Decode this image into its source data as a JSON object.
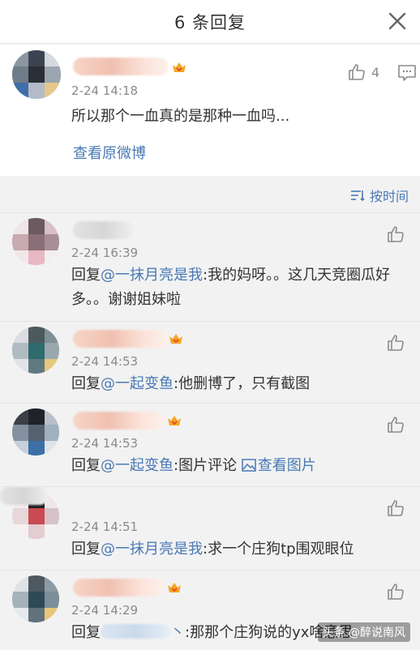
{
  "header": {
    "title": "6 条回复"
  },
  "main_comment": {
    "time": "2-24 14:18",
    "text": "所以那个一血真的是那种一血吗...",
    "like_count": "4",
    "view_original": "查看原微博"
  },
  "sort": {
    "label": "按时间"
  },
  "replies": [
    {
      "time": "2-24 16:39",
      "prefix": "回复",
      "mention": "@一抹月亮是我",
      "body": ":我的妈呀。。这几天竞圈瓜好多。。谢谢姐妹啦"
    },
    {
      "time": "2-24 14:53",
      "prefix": "回复",
      "mention": "@一起变鱼",
      "body": ":他删博了，只有截图"
    },
    {
      "time": "2-24 14:53",
      "prefix": "回复",
      "mention": "@一起变鱼",
      "body": ":图片评论 ",
      "image_link": "查看图片"
    },
    {
      "time": "2-24 14:51",
      "prefix": "回复",
      "mention": "@一抹月亮是我",
      "body": ":求一个庄狗tp围观眼位"
    },
    {
      "time": "2-24 14:29",
      "prefix": "回复",
      "mention_suffix": "丶",
      "body": ":那那个庄狗说的yx啥意思"
    }
  ],
  "watermark": "头条 @醉说南风",
  "colors": {
    "link": "#4a79b5",
    "background": "#f2f2f2",
    "text": "#333333",
    "meta": "#8a8a8a"
  }
}
